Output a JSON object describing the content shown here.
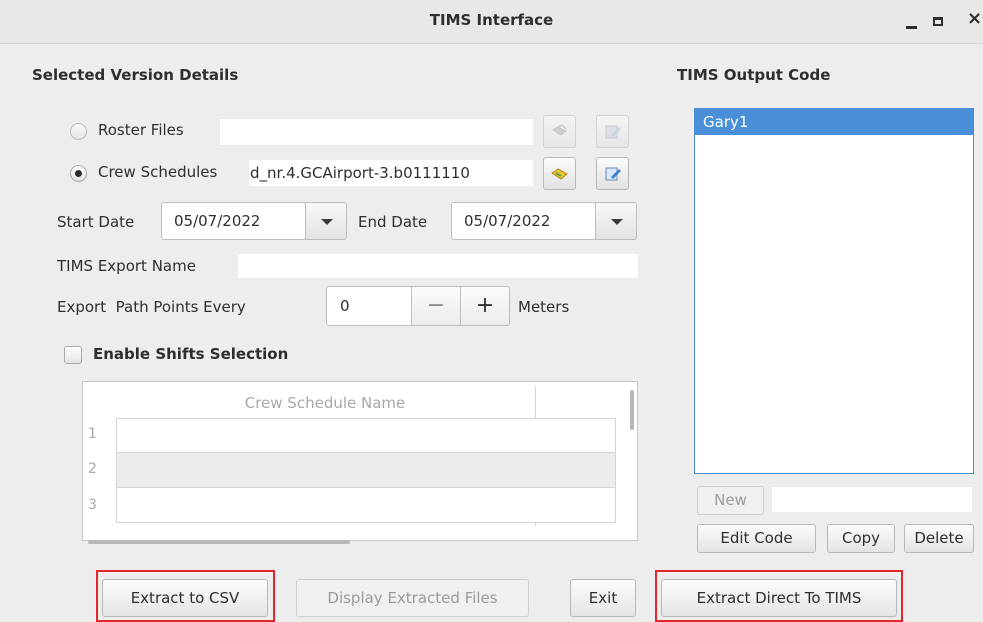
{
  "window": {
    "title": "TIMS Interface",
    "controls": {
      "minimize": "minimize-icon",
      "maximize": "maximize-icon",
      "close": "×"
    }
  },
  "details": {
    "section_title": "Selected Version Details",
    "roster": {
      "label": "Roster Files",
      "selected": false,
      "value": ""
    },
    "crew": {
      "label": "Crew Schedules",
      "selected": true,
      "value": "d_nr.4.GCAirport-3.b0111110"
    },
    "start_date": {
      "label": "Start Date",
      "value": "05/07/2022"
    },
    "end_date": {
      "label": "End Date",
      "value": "05/07/2022"
    },
    "export_name": {
      "label": "TIMS Export Name",
      "value": ""
    },
    "path_points": {
      "label": "Export  Path Points Every",
      "value": "0",
      "minus": "−",
      "plus": "+",
      "unit": "Meters"
    },
    "shifts": {
      "label": "Enable Shifts Selection",
      "checked": false
    },
    "table": {
      "column": "Crew Schedule Name",
      "rows": [
        {
          "num": "1",
          "name": ""
        },
        {
          "num": "2",
          "name": ""
        },
        {
          "num": "3",
          "name": ""
        }
      ]
    }
  },
  "output": {
    "section_title": "TIMS Output Code",
    "items": [
      "Gary1"
    ],
    "selected_index": 0,
    "new_label": "New",
    "new_value": "",
    "edit_label": "Edit Code",
    "copy_label": "Copy",
    "delete_label": "Delete"
  },
  "footer": {
    "extract_csv": "Extract to CSV",
    "display_files": "Display Extracted Files",
    "exit": "Exit",
    "extract_tims": "Extract Direct To TIMS"
  },
  "colors": {
    "selection": "#4a90d9",
    "highlight": "#e3262b",
    "background": "#ededed"
  }
}
